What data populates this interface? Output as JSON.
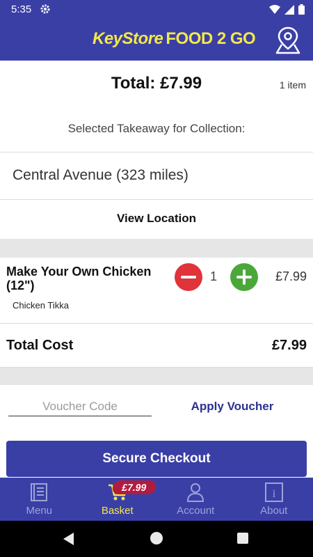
{
  "status_bar": {
    "time": "5:35"
  },
  "header": {
    "brand_name": "KeyStore",
    "brand_suffix": "FOOD 2 GO"
  },
  "summary": {
    "total_label": "Total: £7.99",
    "item_count": "1 item"
  },
  "collection": {
    "label": "Selected Takeaway for Collection:",
    "takeaway": "Central Avenue (323 miles)",
    "view_location": "View Location"
  },
  "basket": {
    "items": [
      {
        "name": "Make Your Own Chicken (12\")",
        "option": "Chicken Tikka",
        "quantity": "1",
        "price": "£7.99"
      }
    ],
    "total_cost_label": "Total Cost",
    "total_cost_value": "£7.99"
  },
  "voucher": {
    "placeholder": "Voucher Code",
    "value": "",
    "apply_label": "Apply Voucher"
  },
  "checkout": {
    "label": "Secure Checkout"
  },
  "tabs": [
    {
      "label": "Menu",
      "icon": "book-icon",
      "active": false
    },
    {
      "label": "Basket",
      "icon": "cart-icon",
      "active": true,
      "badge": "£7.99"
    },
    {
      "label": "Account",
      "icon": "person-icon",
      "active": false
    },
    {
      "label": "About",
      "icon": "info-icon",
      "active": false
    }
  ],
  "colors": {
    "primary": "#3a3fa6",
    "brand_yellow": "#f3e84a",
    "minus_red": "#e0333a",
    "plus_green": "#4aa83b",
    "badge_red": "#b01c3f",
    "link_blue": "#2b3192"
  }
}
